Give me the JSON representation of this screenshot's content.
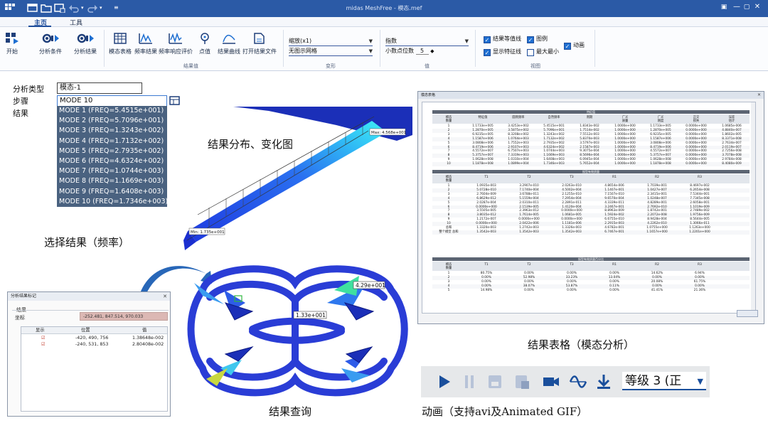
{
  "titlebar": {
    "title": "midas MeshFree - 模态.mef"
  },
  "ribbon": {
    "tabs": [
      {
        "label": "主页",
        "active": true
      },
      {
        "label": "工具",
        "active": false
      }
    ],
    "buttons": [
      {
        "label": "开始",
        "icon": "start-icon"
      },
      {
        "label": "分析条件",
        "icon": "analysis-condition-icon"
      },
      {
        "label": "分析结果",
        "icon": "analysis-result-icon"
      },
      {
        "label": "模态表格",
        "icon": "table-icon"
      },
      {
        "label": "频率结果",
        "icon": "frequency-result-icon"
      },
      {
        "label": "频率响应评价",
        "icon": "frequency-response-icon"
      },
      {
        "label": "点值",
        "icon": "probe-icon"
      },
      {
        "label": "结果曲线",
        "icon": "curve-icon"
      },
      {
        "label": "打开结果文件",
        "icon": "open-file-icon"
      }
    ],
    "groups": {
      "result_value": "结果值",
      "deformation": "变形",
      "value": "值",
      "view": "视图"
    },
    "deform_combo": {
      "value": "缩放(x1)"
    },
    "mesh_combo": {
      "value": "无图示网格"
    },
    "format_combo": {
      "value": "指数"
    },
    "decimal": {
      "label": "小数点位数",
      "value": "5"
    },
    "checkboxes": [
      {
        "label": "结果等值线",
        "checked": true
      },
      {
        "label": "图例",
        "checked": true
      },
      {
        "label": "显示特征线",
        "checked": true
      },
      {
        "label": "最大最小",
        "checked": false
      },
      {
        "label": "动画",
        "checked": true
      }
    ]
  },
  "panel": {
    "type_label": "分析类型",
    "type_value": "模态-1",
    "step_label": "步骤",
    "step_value": "MODE 10 (FREQ=1.7346e+003)",
    "result_label": "结果",
    "modes": [
      "MODE 1 (FREQ=5.4515e+001)",
      "MODE 2 (FREQ=5.7096e+001)",
      "MODE 3 (FREQ=1.3243e+002)",
      "MODE 4 (FREQ=1.7132e+002)",
      "MODE 5 (FREQ=2.7935e+002)",
      "MODE 6 (FREQ=4.6324e+002)",
      "MODE 7 (FREQ=1.0744e+003)",
      "MODE 8 (FREQ=1.1669e+003)",
      "MODE 9 (FREQ=1.6408e+003)",
      "MODE 10 (FREQ=1.7346e+003)"
    ]
  },
  "captions": {
    "distribution": "结果分布、变化图",
    "select": "选择结果（频率）",
    "table": "结果表格（模态分析）",
    "query": "结果查询",
    "animation": "动画（支持avi及Animated GIF）"
  },
  "beam": {
    "max_label": "Max: 4.568e+001",
    "min_label": "Min: 1.735e+001"
  },
  "drone": {
    "label1": "4.29e+001",
    "label2": "1.33e+001"
  },
  "table_window": {
    "title": "模态表格",
    "sec1": "特征值",
    "sec2": "振型有效质量",
    "sec3": "振型有效质量百分比",
    "h1": [
      "模态\n数量",
      "特征值",
      "圆周频率",
      "自然频率",
      "周期",
      "广义\n质量",
      "广义\n刚度",
      "正交\n损失",
      "误差\n估计"
    ],
    "rows1": [
      [
        "1",
        "1.1733e+005",
        "3.4253e+002",
        "5.4515e+001",
        "1.8343e-002",
        "1.0000e+000",
        "1.1733e+005",
        "0.0000e+000",
        "1.0685e-006"
      ],
      [
        "2",
        "1.2870e+005",
        "3.5875e+002",
        "5.7096e+001",
        "1.7514e-002",
        "1.0000e+000",
        "1.2870e+005",
        "0.0000e+000",
        "4.8840e-007"
      ],
      [
        "3",
        "6.9235e+005",
        "8.3208e+002",
        "1.3243e+002",
        "7.5512e-003",
        "1.0000e+000",
        "6.9235e+005",
        "0.0000e+000",
        "1.8602e-005"
      ],
      [
        "4",
        "1.1587e+006",
        "1.0764e+003",
        "1.7132e+002",
        "5.8370e-003",
        "1.0000e+000",
        "1.1587e+006",
        "0.0000e+000",
        "8.3371e-008"
      ],
      [
        "5",
        "3.0808e+006",
        "1.7552e+003",
        "2.7935e+002",
        "3.5797e-003",
        "1.0000e+000",
        "3.0808e+006",
        "0.0000e+000",
        "2.7634e-007"
      ],
      [
        "6",
        "8.4719e+006",
        "2.9107e+003",
        "4.6324e+002",
        "2.1587e-003",
        "1.0000e+000",
        "8.4719e+006",
        "0.0000e+000",
        "2.0119e-007"
      ],
      [
        "7",
        "4.5572e+007",
        "6.7507e+003",
        "1.0744e+003",
        "9.3075e-004",
        "1.0000e+000",
        "4.5572e+007",
        "0.0000e+000",
        "2.7256e-008"
      ],
      [
        "8",
        "5.3757e+007",
        "7.3319e+003",
        "1.1669e+003",
        "8.5696e-004",
        "1.0000e+000",
        "5.3757e+007",
        "0.0000e+000",
        "3.7078e-008"
      ],
      [
        "9",
        "1.0628e+008",
        "1.0310e+004",
        "1.6408e+003",
        "6.0945e-004",
        "1.0000e+000",
        "1.0628e+008",
        "0.0000e+000",
        "2.9784e-008"
      ],
      [
        "10",
        "1.1878e+008",
        "1.0899e+004",
        "1.7346e+003",
        "5.7652e-004",
        "1.0000e+000",
        "1.1878e+008",
        "0.0000e+000",
        "8.4080e-009"
      ]
    ],
    "h2": [
      "模态\n数量",
      "T1",
      "T2",
      "T3",
      "R1",
      "R2",
      "R3"
    ],
    "rows2": [
      [
        "1",
        "1.0935e-003",
        "3.2907e-010",
        "2.0263e-010",
        "4.8654e-006",
        "1.7039e-001",
        "8.4697e-002"
      ],
      [
        "2",
        "5.0728e-010",
        "7.1740e-004",
        "4.5002e-004",
        "1.1407e-001",
        "1.0427e-007",
        "6.2654e-008"
      ],
      [
        "3",
        "2.7604e-009",
        "3.6788e-011",
        "2.1255e-010",
        "7.1507e-010",
        "2.3415e-001",
        "7.5344e-001"
      ],
      [
        "4",
        "6.8629e-012",
        "5.1559e-004",
        "7.2954e-004",
        "9.6570e-004",
        "1.0248e-007",
        "7.7345e-008"
      ],
      [
        "5",
        "2.0287e-004",
        "2.0310e-011",
        "2.2891e-011",
        "4.3339e-011",
        "4.8289e-001",
        "2.6058e-001"
      ],
      [
        "6",
        "0.0000e+000",
        "2.1539e-005",
        "1.4120e-004",
        "3.2467e-001",
        "2.7692e-010",
        "1.1019e-009"
      ],
      [
        "7",
        "3.5505e-005",
        "2.3963e-012",
        "0.0000e+000",
        "8.8963e-009",
        "1.8742e-001",
        "2.7489e-002"
      ],
      [
        "8",
        "3.8035e-012",
        "1.7614e-005",
        "1.0681e-005",
        "1.5924e-002",
        "2.2072e-008",
        "1.9756e-009"
      ],
      [
        "9",
        "1.2172e-007",
        "0.0000e+000",
        "0.0000e+000",
        "6.6755e-010",
        "8.9428e-004",
        "8.5644e-005"
      ],
      [
        "10",
        "0.0000e+000",
        "2.0422e-006",
        "1.1181e-006",
        "2.2915e-003",
        "4.2262e-010",
        "1.3066e-011"
      ],
      [
        "总和",
        "1.3320e-003",
        "1.2742e-003",
        "1.3326e-003",
        "4.6782e-001",
        "1.0755e+000",
        "1.1263e+000"
      ],
      [
        "整个模型\n总和",
        "1.3542e-003",
        "1.3542e-003",
        "1.3542e-003",
        "6.7467e-001",
        "1.1657e+000",
        "1.2201e+000"
      ]
    ],
    "h3": [
      "模态\n数量",
      "T1",
      "T2",
      "T3",
      "R1",
      "R2",
      "R3"
    ],
    "rows3": [
      [
        "1",
        "80.75%",
        "0.00%",
        "0.00%",
        "0.00%",
        "14.62%",
        "6.94%"
      ],
      [
        "2",
        "0.00%",
        "52.98%",
        "33.23%",
        "13.04%",
        "0.00%",
        "0.00%"
      ],
      [
        "3",
        "0.00%",
        "0.00%",
        "0.00%",
        "0.00%",
        "20.08%",
        "61.75%"
      ],
      [
        "4",
        "0.00%",
        "38.07%",
        "53.87%",
        "0.11%",
        "0.00%",
        "0.00%"
      ],
      [
        "5",
        "14.98%",
        "0.00%",
        "0.00%",
        "0.00%",
        "41.41%",
        "21.36%"
      ]
    ]
  },
  "mark_window": {
    "title": "分析结果标记",
    "group": "结果",
    "coord_label": "坐标",
    "coord_value": "-252.481, 847.514, 970.033",
    "headers": [
      "显示",
      "位置",
      "值"
    ],
    "rows": [
      {
        "position": "-420, 490, 756",
        "value": "1.38648e-002"
      },
      {
        "position": "-240, 531, 853",
        "value": "2.80408e-002"
      }
    ]
  },
  "animation": {
    "level": "等级 3 (正"
  }
}
